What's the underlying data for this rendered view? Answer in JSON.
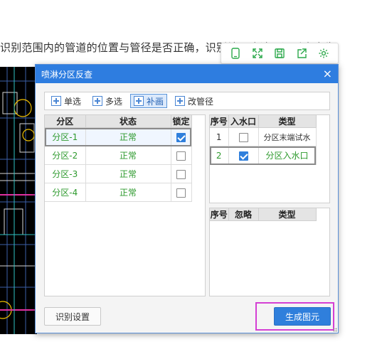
{
  "background": {
    "doc_text": "识别范围内的管道的位置与管径是否正确，识别结果确认无误后点击生"
  },
  "dialog": {
    "title": "喷淋分区反查",
    "close_glyph": "×",
    "toolbar": {
      "items": [
        {
          "label": "单选",
          "active": false
        },
        {
          "label": "多选",
          "active": false
        },
        {
          "label": "补画",
          "active": true
        },
        {
          "label": "改管径",
          "active": false
        }
      ]
    },
    "zone_table": {
      "headers": [
        "分区",
        "状态",
        "锁定"
      ],
      "rows": [
        {
          "zone": "分区-1",
          "status": "正常",
          "locked": true
        },
        {
          "zone": "分区-2",
          "status": "正常",
          "locked": false
        },
        {
          "zone": "分区-3",
          "status": "正常",
          "locked": false
        },
        {
          "zone": "分区-4",
          "status": "正常",
          "locked": false
        }
      ]
    },
    "inlet_table": {
      "headers": [
        "序号",
        "入水口",
        "类型"
      ],
      "rows": [
        {
          "index": "1",
          "checked": false,
          "type": "分区末端试水"
        },
        {
          "index": "2",
          "checked": true,
          "type": "分区入水口"
        }
      ]
    },
    "ignore_table": {
      "headers": [
        "序号",
        "忽略",
        "类型"
      ]
    },
    "buttons": {
      "settings": "识别设置",
      "generate": "生成图元"
    }
  },
  "colors": {
    "title_bar": "#2e7de0",
    "accent": "#2f7fdc",
    "zone_text": "#2e9a2e",
    "highlight_box": "#d43fd4"
  },
  "icons": {
    "mini_toolbar": [
      "phone-icon",
      "expand-icon",
      "save-icon",
      "share-icon",
      "gear-icon"
    ]
  }
}
